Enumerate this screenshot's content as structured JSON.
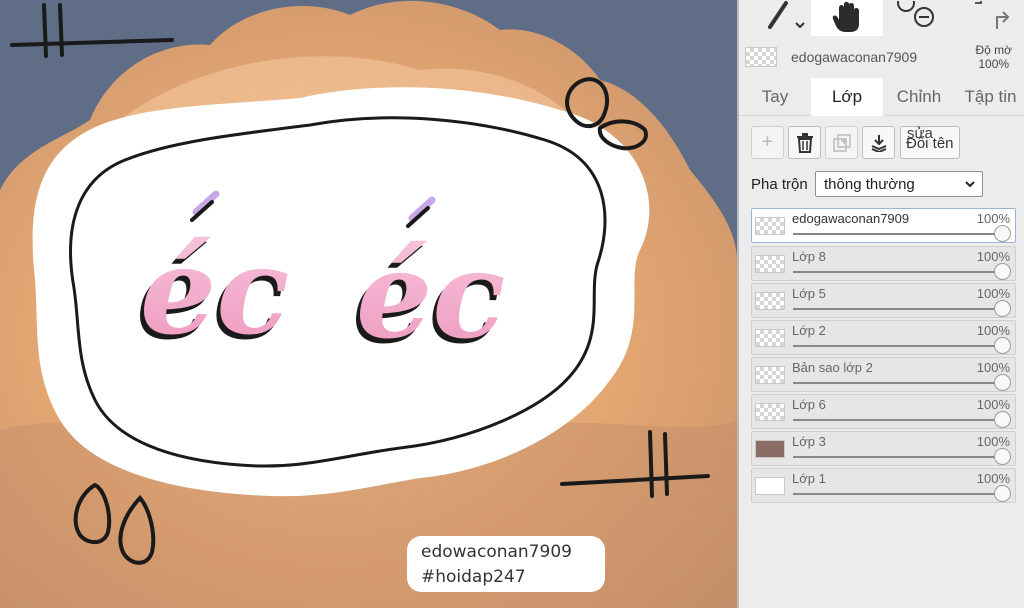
{
  "canvas": {
    "sticker_text_left": "éc",
    "sticker_text_right": "éc",
    "watermark_line1": "edowaconan7909",
    "watermark_line2": "#hoidap247"
  },
  "toolbar": {
    "brush_icon": "brush-icon",
    "hand_icon": "hand-icon",
    "zoom_icon": "zoom-out-icon",
    "redo_icon": "redo-icon"
  },
  "current_layer": {
    "name": "edogawaconan7909",
    "opacity_label_line1": "Độ mờ",
    "opacity_value": "100%"
  },
  "tabs": [
    {
      "label": "Tay",
      "active": false
    },
    {
      "label": "Lớp",
      "active": true
    },
    {
      "label": "Chỉnh",
      "active": false
    },
    {
      "label": "Tập tin",
      "active": false
    }
  ],
  "actions": {
    "add_label": "+",
    "rename_sub": "sửa",
    "rename_label": "Đổi tên"
  },
  "blend": {
    "label": "Pha trộn",
    "value": "thông thường"
  },
  "layers": [
    {
      "name": "edogawaconan7909",
      "opacity": "100%",
      "selected": true
    },
    {
      "name": "Lớp 8",
      "opacity": "100%",
      "selected": false
    },
    {
      "name": "Lớp 5",
      "opacity": "100%",
      "selected": false
    },
    {
      "name": "Lớp 2",
      "opacity": "100%",
      "selected": false
    },
    {
      "name": "Bản sao lớp 2",
      "opacity": "100%",
      "selected": false
    },
    {
      "name": "Lớp 6",
      "opacity": "100%",
      "selected": false
    },
    {
      "name": "Lớp 3",
      "opacity": "100%",
      "selected": false
    },
    {
      "name": "Lớp 1",
      "opacity": "100%",
      "selected": false
    }
  ],
  "colors": {
    "sky": "#5f6e86",
    "cloud": "#e9b07c",
    "pink": "#f3a9c8",
    "panel": "#ececec"
  }
}
